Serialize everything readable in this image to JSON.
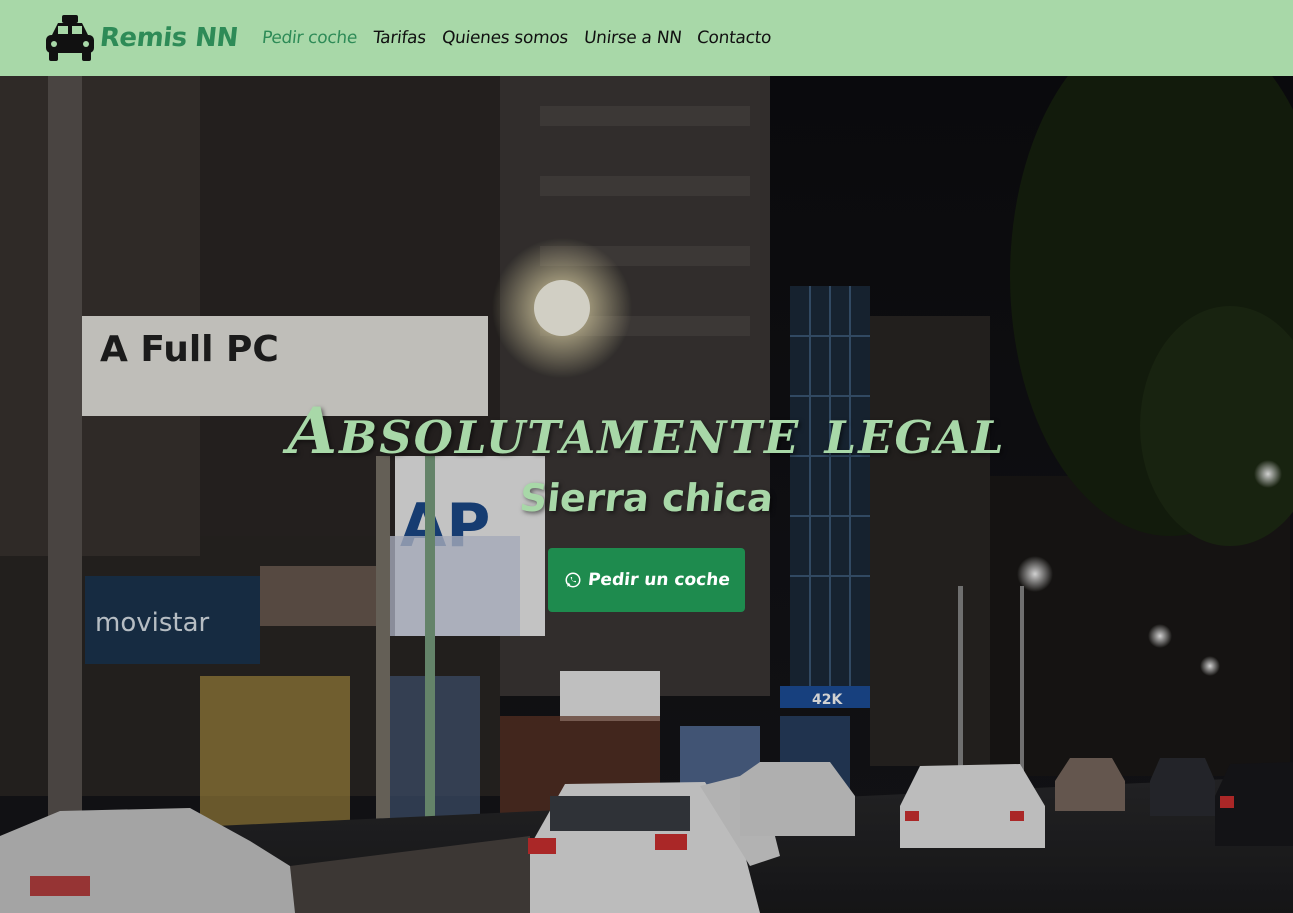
{
  "brand": {
    "name": "Remis NN",
    "logo_icon": "taxi-icon"
  },
  "nav": {
    "items": [
      {
        "label": "Pedir coche",
        "active": true
      },
      {
        "label": "Tarifas",
        "active": false
      },
      {
        "label": "Quienes somos",
        "active": false
      },
      {
        "label": "Unirse a NN",
        "active": false
      },
      {
        "label": "Contacto",
        "active": false
      }
    ]
  },
  "hero": {
    "background": "night-city-street-photo",
    "title": "Absolutamente legal",
    "subtitle": "Sierra chica",
    "cta_label": "Pedir un coche",
    "cta_icon": "whatsapp-icon"
  },
  "colors": {
    "navbar_bg": "#a8d8a8",
    "accent_green": "#2e8b57",
    "button_green": "#1e8b4e",
    "hero_text": "#a8d8a8"
  }
}
